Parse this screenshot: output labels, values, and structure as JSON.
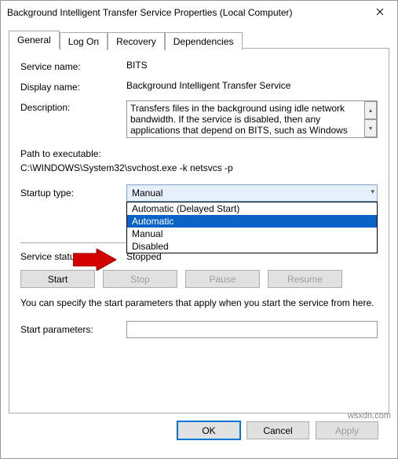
{
  "window": {
    "title": "Background Intelligent Transfer Service Properties (Local Computer)"
  },
  "tabs": {
    "general": "General",
    "logon": "Log On",
    "recovery": "Recovery",
    "dependencies": "Dependencies"
  },
  "labels": {
    "service_name": "Service name:",
    "display_name": "Display name:",
    "description": "Description:",
    "path": "Path to executable:",
    "startup_type": "Startup type:",
    "service_status": "Service status:",
    "start_params": "Start parameters:"
  },
  "values": {
    "service_name": "BITS",
    "display_name": "Background Intelligent Transfer Service",
    "description": "Transfers files in the background using idle network bandwidth. If the service is disabled, then any applications that depend on BITS, such as Windows",
    "path": "C:\\WINDOWS\\System32\\svchost.exe -k netsvcs -p",
    "startup_selected": "Manual",
    "service_status": "Stopped",
    "start_params": ""
  },
  "startup_options": {
    "o0": "Automatic (Delayed Start)",
    "o1": "Automatic",
    "o2": "Manual",
    "o3": "Disabled"
  },
  "buttons": {
    "start": "Start",
    "stop": "Stop",
    "pause": "Pause",
    "resume": "Resume",
    "ok": "OK",
    "cancel": "Cancel",
    "apply": "Apply"
  },
  "hint": "You can specify the start parameters that apply when you start the service from here.",
  "watermark": "wsxdn.com"
}
